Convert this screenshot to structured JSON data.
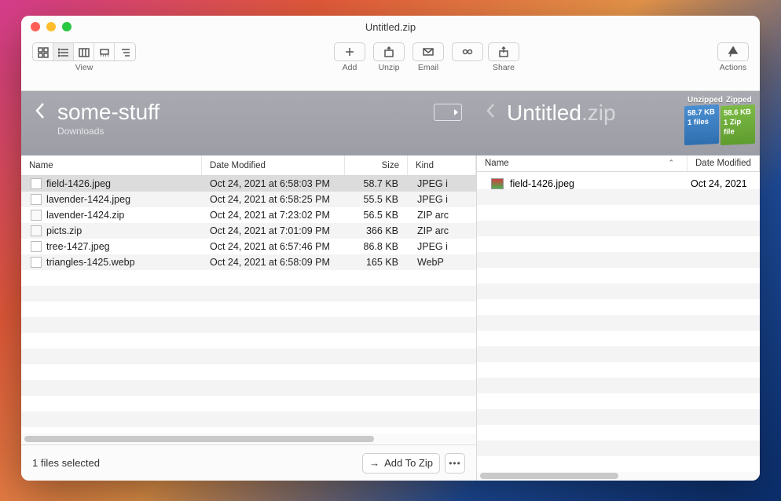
{
  "window_title": "Untitled.zip",
  "toolbar": {
    "view_label": "View",
    "add_label": "Add",
    "unzip_label": "Unzip",
    "email_label": "Email",
    "share_label": "Share",
    "actions_label": "Actions"
  },
  "pathbar": {
    "left_title": "some-stuff",
    "left_sub": "Downloads",
    "right_title": "Untitled",
    "right_ext": ".zip",
    "unzipped_label": "Unzipped",
    "zipped_label": "Zipped",
    "unzipped_size": "58.7 KB",
    "unzipped_files": "1 files",
    "zipped_size": "58.6 KB",
    "zipped_files": "1 Zip file"
  },
  "left": {
    "cols": {
      "name": "Name",
      "date": "Date Modified",
      "size": "Size",
      "kind": "Kind"
    },
    "files": [
      {
        "name": "field-1426.jpeg",
        "date": "Oct 24, 2021 at 6:58:03 PM",
        "size": "58.7 KB",
        "kind": "JPEG i",
        "icon": "img",
        "sel": true
      },
      {
        "name": "lavender-1424.jpeg",
        "date": "Oct 24, 2021 at 6:58:25 PM",
        "size": "55.5 KB",
        "kind": "JPEG i",
        "icon": "img"
      },
      {
        "name": "lavender-1424.zip",
        "date": "Oct 24, 2021 at 7:23:02 PM",
        "size": "56.5 KB",
        "kind": "ZIP arc",
        "icon": "zip"
      },
      {
        "name": "picts.zip",
        "date": "Oct 24, 2021 at 7:01:09 PM",
        "size": "366 KB",
        "kind": "ZIP arc",
        "icon": "zip"
      },
      {
        "name": "tree-1427.jpeg",
        "date": "Oct 24, 2021 at 6:57:46 PM",
        "size": "86.8 KB",
        "kind": "JPEG i",
        "icon": "img"
      },
      {
        "name": "triangles-1425.webp",
        "date": "Oct 24, 2021 at 6:58:09 PM",
        "size": "165 KB",
        "kind": "WebP",
        "icon": "img"
      }
    ],
    "status": "1 files selected",
    "add_to_zip": "Add To Zip"
  },
  "right": {
    "cols": {
      "name": "Name",
      "date": "Date Modified"
    },
    "files": [
      {
        "name": "field-1426.jpeg",
        "date": "Oct 24, 2021"
      }
    ]
  }
}
